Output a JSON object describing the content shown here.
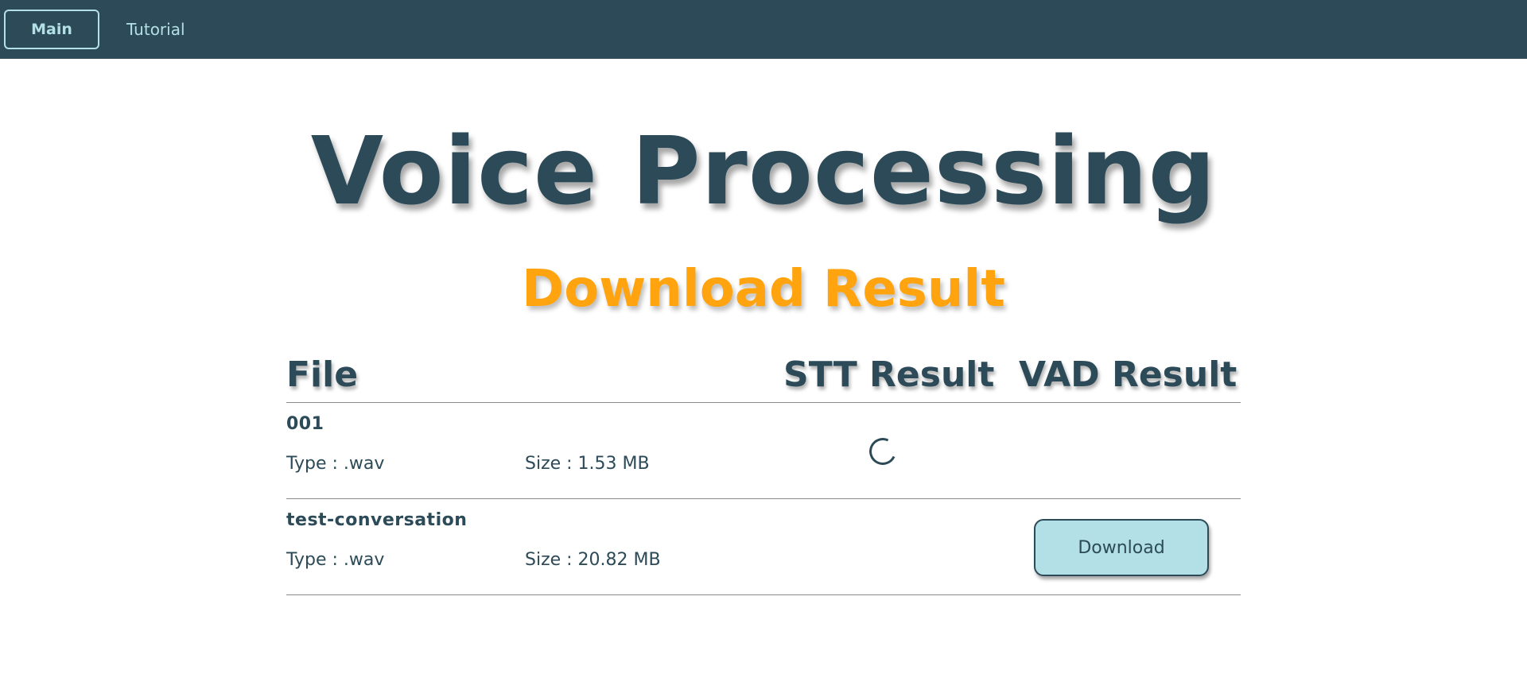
{
  "nav": {
    "main_label": "Main",
    "tutorial_label": "Tutorial"
  },
  "page": {
    "title": "Voice Processing",
    "subtitle": "Download Result"
  },
  "table": {
    "headers": {
      "file": "File",
      "stt": "STT Result",
      "vad": "VAD Result"
    },
    "rows": [
      {
        "name": "001",
        "type": "Type : .wav",
        "size": "Size : 1.53 MB",
        "stt_status": "loading-spinner-icon"
      },
      {
        "name": "test-conversation",
        "type": "Type : .wav",
        "size": "Size : 20.82 MB",
        "vad_action": "Download"
      }
    ]
  },
  "colors": {
    "nav_bg": "#2c4a57",
    "accent": "#ffa40f",
    "button_bg": "#b3e0e6",
    "text": "#2c4a57"
  }
}
